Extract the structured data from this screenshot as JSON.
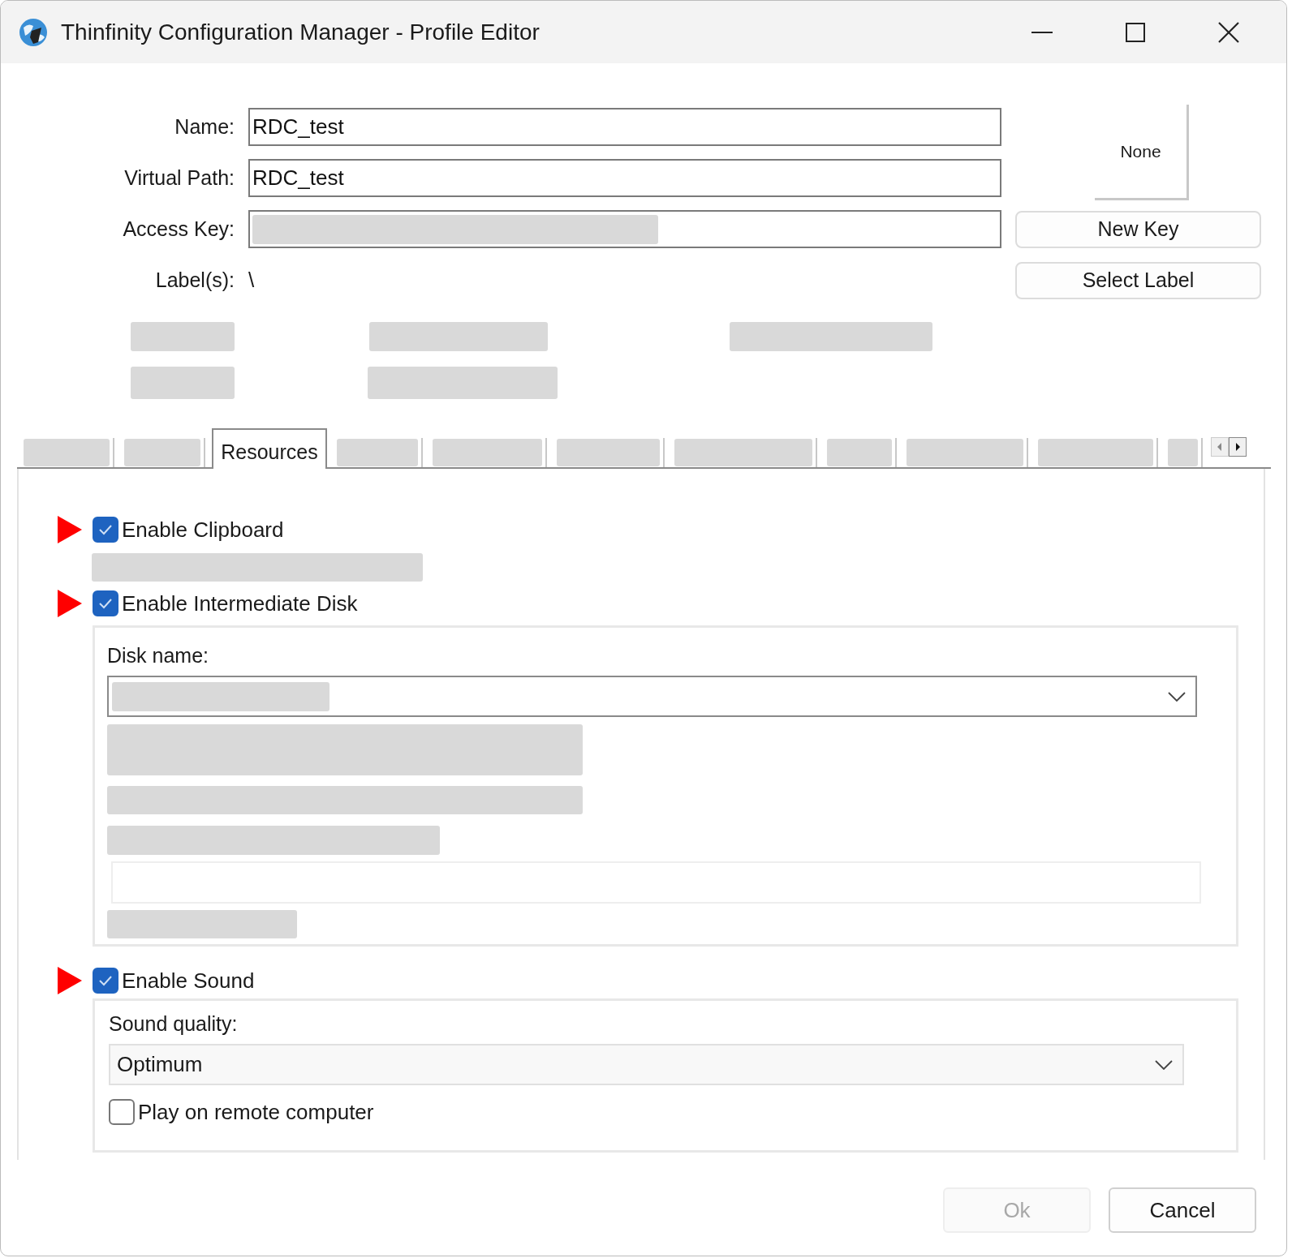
{
  "window": {
    "title": "Thinfinity Configuration Manager - Profile Editor"
  },
  "fields": [
    {
      "label": "Name:",
      "kind": "text",
      "value": "RDC_test"
    },
    {
      "label": "Virtual Path:",
      "kind": "text",
      "value": "RDC_test"
    },
    {
      "label": "Access Key:",
      "kind": "masked"
    }
  ],
  "labels_row": {
    "label": "Label(s):",
    "value": "\\"
  },
  "image_box": {
    "text": "None"
  },
  "side_buttons": [
    "New Key",
    "Select Label"
  ],
  "tabs": [
    {
      "selected": false
    },
    {
      "selected": false
    },
    {
      "label": "Resources",
      "selected": true
    },
    {
      "selected": false
    },
    {
      "selected": false
    },
    {
      "selected": false
    },
    {
      "selected": false
    },
    {
      "selected": false
    },
    {
      "selected": false
    },
    {
      "selected": false
    },
    {
      "selected": false
    }
  ],
  "clipboard": {
    "label": "Enable Clipboard",
    "checked": true,
    "arrow": true
  },
  "intermediate_disk": {
    "label": "Enable Intermediate Disk",
    "checked": true,
    "arrow": true,
    "disk_label": "Disk name:"
  },
  "sound": {
    "label": "Enable Sound",
    "checked": true,
    "arrow": true,
    "quality_label": "Sound quality:",
    "quality": "Optimum",
    "play_remote": {
      "label": "Play on remote computer",
      "checked": false
    }
  },
  "footer_buttons": [
    {
      "label": "Ok",
      "disabled": true
    },
    {
      "label": "Cancel",
      "disabled": false
    }
  ]
}
